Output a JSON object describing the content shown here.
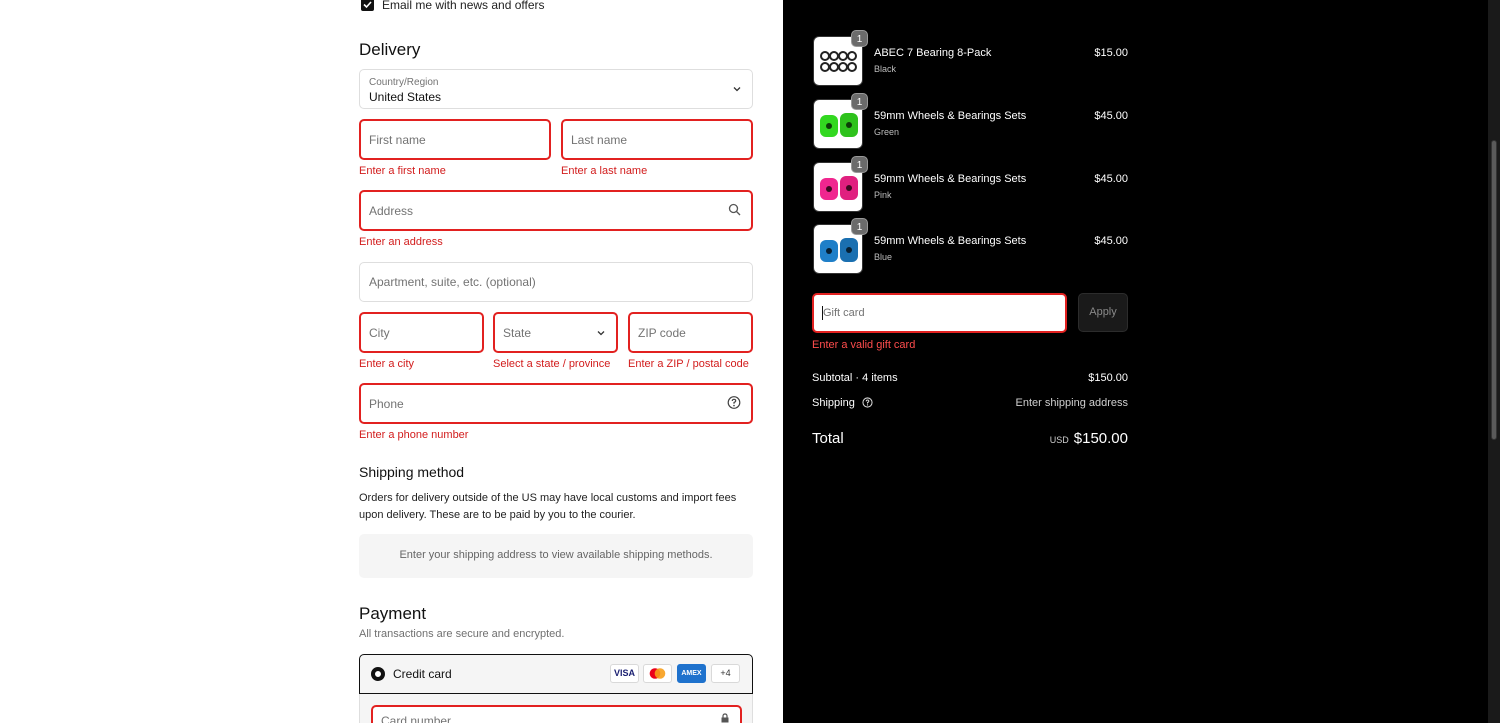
{
  "contact": {
    "email_news_label": "Email me with news and offers",
    "email_news_checked": true
  },
  "delivery": {
    "title": "Delivery",
    "country_label": "Country/Region",
    "country_value": "United States",
    "first_name_placeholder": "First name",
    "first_name_error": "Enter a first name",
    "last_name_placeholder": "Last name",
    "last_name_error": "Enter a last name",
    "address_placeholder": "Address",
    "address_error": "Enter an address",
    "apartment_placeholder": "Apartment, suite, etc. (optional)",
    "city_placeholder": "City",
    "city_error": "Enter a city",
    "state_placeholder": "State",
    "state_error": "Select a state / province",
    "zip_placeholder": "ZIP code",
    "zip_error": "Enter a ZIP / postal code",
    "phone_placeholder": "Phone",
    "phone_error": "Enter a phone number"
  },
  "shipping": {
    "title": "Shipping method",
    "note_line1": "Orders for delivery outside of the US may have local customs and import fees",
    "note_line2": "upon delivery. These are to be paid by you to the courier.",
    "placeholder_box": "Enter your shipping address to view available shipping methods."
  },
  "payment": {
    "title": "Payment",
    "subtitle": "All transactions are secure and encrypted.",
    "method_label": "Credit card",
    "card_logos": [
      "VISA",
      "MC",
      "AMEX"
    ],
    "more_count": "+4",
    "card_number_placeholder": "Card number"
  },
  "order": {
    "items": [
      {
        "name": "ABEC 7 Bearing 8-Pack",
        "variant": "Black",
        "price": "$15.00",
        "qty": "1",
        "color": "#222222"
      },
      {
        "name": "59mm Wheels & Bearings Sets",
        "variant": "Green",
        "price": "$45.00",
        "qty": "1",
        "color": "#32d820"
      },
      {
        "name": "59mm Wheels & Bearings Sets",
        "variant": "Pink",
        "price": "$45.00",
        "qty": "1",
        "color": "#f0268f"
      },
      {
        "name": "59mm Wheels & Bearings Sets",
        "variant": "Blue",
        "price": "$45.00",
        "qty": "1",
        "color": "#1f7fc8"
      }
    ],
    "gift_placeholder": "Gift card",
    "apply_label": "Apply",
    "gift_error": "Enter a valid gift card",
    "subtotal_label": "Subtotal · 4 items",
    "subtotal_value": "$150.00",
    "shipping_label": "Shipping",
    "shipping_value": "Enter shipping address",
    "total_label": "Total",
    "currency": "USD",
    "total_value": "$150.00"
  }
}
